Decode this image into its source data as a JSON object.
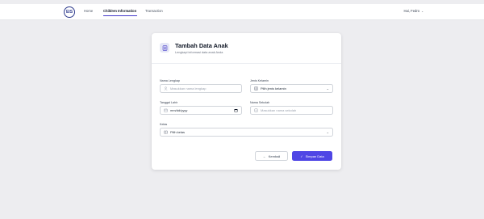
{
  "navbar": {
    "logo_text": "EIS",
    "links": [
      "Home",
      "Children Information",
      "Transaction"
    ],
    "user_name": "Hai, Fedro"
  },
  "form": {
    "title": "Tambah Data Anak",
    "subtitle": "Lengkapi informasi data anak Anda",
    "nama_lengkap": {
      "label": "Nama Lengkap",
      "placeholder": "Masukkan nama lengkap"
    },
    "jenis_kelamin": {
      "label": "Jenis Kelamin",
      "value": "Pilih jenis kelamin"
    },
    "tanggal_lahir": {
      "label": "Tanggal Lahir",
      "value": "mm/dd/yyyy"
    },
    "nama_sekolah": {
      "label": "Nama Sekolah",
      "placeholder": "Masukkan nama sekolah"
    },
    "kelas": {
      "label": "Kelas",
      "value": "Pilih kelas"
    },
    "back_label": "Kembali",
    "save_label": "Simpan Data"
  },
  "colors": {
    "primary": "#4f46e5",
    "background": "#ededf0"
  }
}
